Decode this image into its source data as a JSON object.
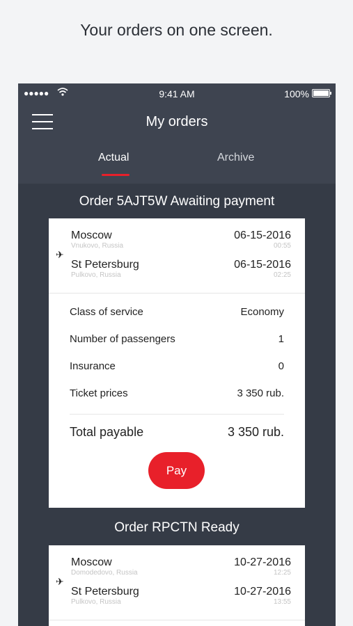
{
  "tagline": "Your orders on one screen.",
  "status": {
    "signal": "●●●●●",
    "time": "9:41 AM",
    "battery": "100%"
  },
  "navbar": {
    "title": "My orders",
    "tabs": {
      "actual": "Actual",
      "archive": "Archive"
    }
  },
  "orders": [
    {
      "heading": "Order 5AJT5W Awaiting payment",
      "from": {
        "city": "Moscow",
        "airport": "Vnukovo, Russia",
        "date": "06-15-2016",
        "time": "00:55"
      },
      "to": {
        "city": "St Petersburg",
        "airport": "Pulkovo, Russia",
        "date": "06-15-2016",
        "time": "02:25"
      },
      "details": [
        {
          "label": "Class of service",
          "value": "Economy"
        },
        {
          "label": "Number of passengers",
          "value": "1"
        },
        {
          "label": "Insurance",
          "value": "0"
        },
        {
          "label": "Ticket prices",
          "value": "3 350 rub."
        }
      ],
      "total": {
        "label": "Total payable",
        "value": "3 350 rub."
      },
      "pay_label": "Pay"
    },
    {
      "heading": "Order RPCTN Ready",
      "from": {
        "city": "Moscow",
        "airport": "Domodedovo, Russia",
        "date": "10-27-2016",
        "time": "12:25"
      },
      "to": {
        "city": "St Petersburg",
        "airport": "Pulkovo, Russia",
        "date": "10-27-2016",
        "time": "13:55"
      }
    }
  ],
  "colors": {
    "accent": "#e8202a",
    "header": "#3e4450",
    "background": "#353b46"
  },
  "icons": {
    "menu": "hamburger-menu-icon",
    "plane": "airplane-icon",
    "wifi": "wifi-icon",
    "battery": "battery-icon"
  }
}
